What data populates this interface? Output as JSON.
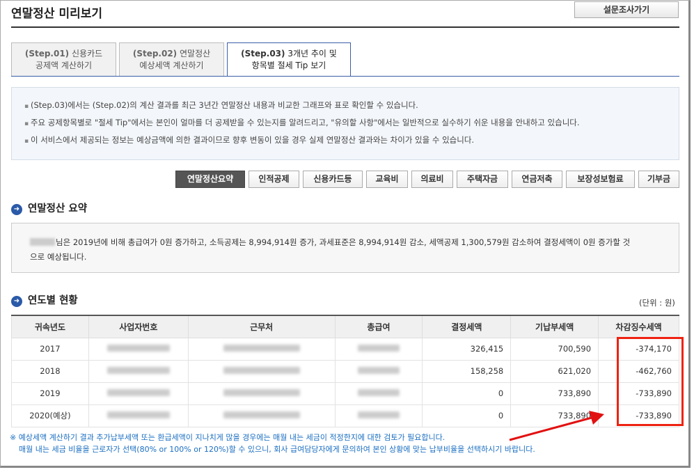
{
  "header": {
    "title": "연말정산 미리보기",
    "survey_button": "설문조사가기"
  },
  "tabs": [
    {
      "step": "(Step.01)",
      "label_a": "신용카드",
      "label_b": "공제액 계산하기"
    },
    {
      "step": "(Step.02)",
      "label_a": "연말정산",
      "label_b": "예상세액 계산하기"
    },
    {
      "step": "(Step.03)",
      "label_a": "3개년 추이 및",
      "label_b": "항목별 절세 Tip 보기"
    }
  ],
  "notice": [
    "(Step.03)에서는 (Step.02)의 계산 결과를 최근 3년간 연말정산 내용과 비교한 그래프와 표로 확인할 수 있습니다.",
    "주요 공제항목별로 \"절세 Tip\"에서는 본인이 얼마를 더 공제받을 수 있는지를 알려드리고, \"유의할 사항\"에서는 일반적으로 실수하기 쉬운 내용을 안내하고 있습니다.",
    "이 서비스에서 제공되는 정보는 예상금액에 의한 결과이므로 향후 변동이 있을 경우 실제 연말정산 결과와는 차이가 있을 수 있습니다."
  ],
  "categories": [
    "연말정산요약",
    "인적공제",
    "신용카드등",
    "교육비",
    "의료비",
    "주택자금",
    "연금저축",
    "보장성보험료",
    "기부금"
  ],
  "summary_section": {
    "title": "연말정산 요약",
    "text_line1": "님은 2019년에 비해 총급여가 0원 증가하고, 소득공제는 8,994,914원 증가, 과세표준은 8,994,914원 감소, 세액공제 1,300,579원 감소하여 결정세액이 0원 증가할 것",
    "text_line2": "으로 예상됩니다."
  },
  "yearly_section": {
    "title": "연도별 현황",
    "unit": "(단위 : 원)",
    "columns": [
      "귀속년도",
      "사업자번호",
      "근무처",
      "총급여",
      "결정세액",
      "기납부세액",
      "차감징수세액"
    ],
    "rows": [
      {
        "year": "2017",
        "decided_tax": "326,415",
        "prepaid_tax": "700,590",
        "balance": "-374,170"
      },
      {
        "year": "2018",
        "decided_tax": "158,258",
        "prepaid_tax": "621,020",
        "balance": "-462,760"
      },
      {
        "year": "2019",
        "decided_tax": "0",
        "prepaid_tax": "733,890",
        "balance": "-733,890"
      },
      {
        "year": "2020(예상)",
        "decided_tax": "0",
        "prepaid_tax": "733,890",
        "balance": "-733,890"
      }
    ]
  },
  "footnote": {
    "line1": "※ 예상세액 계산하기 결과 추가납부세액 또는 환급세액이 지나치게 많을 경우에는 매월 내는 세금이 적정한지에 대한 검토가 필요합니다.",
    "line2": "매월 내는 세금 비율을 근로자가 선택(80% or 100% or 120%)할 수 있으니, 회사 급여담당자에게 문의하여 본인 상황에 맞는 납부비율을 선택하시기 바랍니다."
  },
  "colors": {
    "accent": "#2a5aa8",
    "highlight": "#e21111",
    "note": "#1b6fc2"
  },
  "icons": [
    "section-bullet-icon",
    "annotation-arrow-icon"
  ]
}
